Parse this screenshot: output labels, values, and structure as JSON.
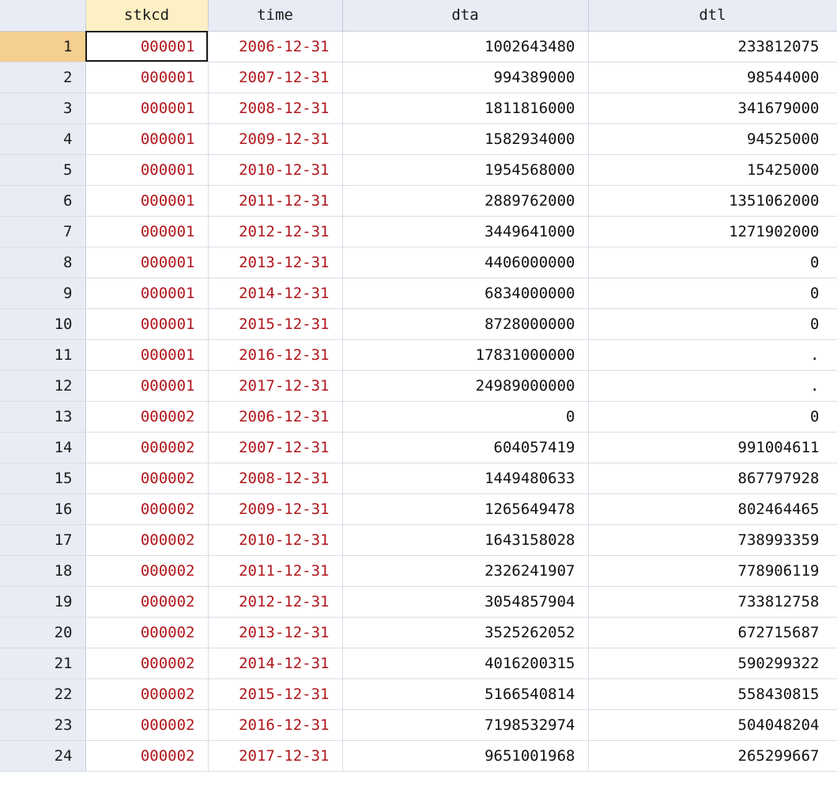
{
  "columns": [
    "stkcd",
    "time",
    "dta",
    "dtl"
  ],
  "rows": [
    {
      "n": "1",
      "stkcd": "000001",
      "time": "2006-12-31",
      "dta": "1002643480",
      "dtl": "233812075"
    },
    {
      "n": "2",
      "stkcd": "000001",
      "time": "2007-12-31",
      "dta": "994389000",
      "dtl": "98544000"
    },
    {
      "n": "3",
      "stkcd": "000001",
      "time": "2008-12-31",
      "dta": "1811816000",
      "dtl": "341679000"
    },
    {
      "n": "4",
      "stkcd": "000001",
      "time": "2009-12-31",
      "dta": "1582934000",
      "dtl": "94525000"
    },
    {
      "n": "5",
      "stkcd": "000001",
      "time": "2010-12-31",
      "dta": "1954568000",
      "dtl": "15425000"
    },
    {
      "n": "6",
      "stkcd": "000001",
      "time": "2011-12-31",
      "dta": "2889762000",
      "dtl": "1351062000"
    },
    {
      "n": "7",
      "stkcd": "000001",
      "time": "2012-12-31",
      "dta": "3449641000",
      "dtl": "1271902000"
    },
    {
      "n": "8",
      "stkcd": "000001",
      "time": "2013-12-31",
      "dta": "4406000000",
      "dtl": "0"
    },
    {
      "n": "9",
      "stkcd": "000001",
      "time": "2014-12-31",
      "dta": "6834000000",
      "dtl": "0"
    },
    {
      "n": "10",
      "stkcd": "000001",
      "time": "2015-12-31",
      "dta": "8728000000",
      "dtl": "0"
    },
    {
      "n": "11",
      "stkcd": "000001",
      "time": "2016-12-31",
      "dta": "17831000000",
      "dtl": "."
    },
    {
      "n": "12",
      "stkcd": "000001",
      "time": "2017-12-31",
      "dta": "24989000000",
      "dtl": "."
    },
    {
      "n": "13",
      "stkcd": "000002",
      "time": "2006-12-31",
      "dta": "0",
      "dtl": "0"
    },
    {
      "n": "14",
      "stkcd": "000002",
      "time": "2007-12-31",
      "dta": "604057419",
      "dtl": "991004611"
    },
    {
      "n": "15",
      "stkcd": "000002",
      "time": "2008-12-31",
      "dta": "1449480633",
      "dtl": "867797928"
    },
    {
      "n": "16",
      "stkcd": "000002",
      "time": "2009-12-31",
      "dta": "1265649478",
      "dtl": "802464465"
    },
    {
      "n": "17",
      "stkcd": "000002",
      "time": "2010-12-31",
      "dta": "1643158028",
      "dtl": "738993359"
    },
    {
      "n": "18",
      "stkcd": "000002",
      "time": "2011-12-31",
      "dta": "2326241907",
      "dtl": "778906119"
    },
    {
      "n": "19",
      "stkcd": "000002",
      "time": "2012-12-31",
      "dta": "3054857904",
      "dtl": "733812758"
    },
    {
      "n": "20",
      "stkcd": "000002",
      "time": "2013-12-31",
      "dta": "3525262052",
      "dtl": "672715687"
    },
    {
      "n": "21",
      "stkcd": "000002",
      "time": "2014-12-31",
      "dta": "4016200315",
      "dtl": "590299322"
    },
    {
      "n": "22",
      "stkcd": "000002",
      "time": "2015-12-31",
      "dta": "5166540814",
      "dtl": "558430815"
    },
    {
      "n": "23",
      "stkcd": "000002",
      "time": "2016-12-31",
      "dta": "7198532974",
      "dtl": "504048204"
    },
    {
      "n": "24",
      "stkcd": "000002",
      "time": "2017-12-31",
      "dta": "9651001968",
      "dtl": "265299667"
    }
  ],
  "colors": {
    "string_value": "#b0161c",
    "numeric_value": "#111111",
    "header_bg": "#e9ecf5",
    "active_header_bg": "#fdf0c4",
    "active_row_bg": "#f5cf8f",
    "gridline": "#d9dde6"
  }
}
